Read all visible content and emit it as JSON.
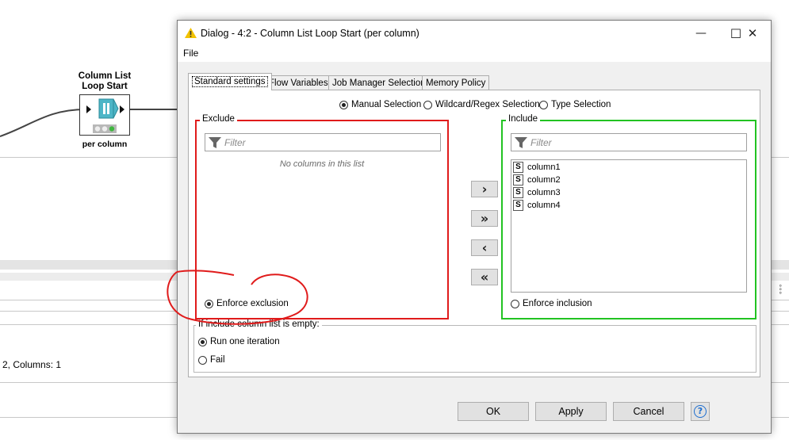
{
  "background": {
    "node": {
      "title": "Column List Loop Start",
      "subtitle": "per column"
    },
    "status_text": "2, Columns: 1",
    "right_edge_glyph": "°°°"
  },
  "dialog": {
    "title": "Dialog - 4:2 - Column List Loop Start (per column)",
    "window_controls": {
      "minimize": "—",
      "maximize": "☐",
      "close": "✕"
    },
    "menu": [
      "File"
    ],
    "tabs": [
      {
        "label": "Standard settings",
        "active": true
      },
      {
        "label": "Flow Variables",
        "active": false
      },
      {
        "label": "Job Manager Selection",
        "active": false
      },
      {
        "label": "Memory Policy",
        "active": false
      }
    ],
    "selection_modes": [
      {
        "label": "Manual Selection",
        "selected": true
      },
      {
        "label": "Wildcard/Regex Selection",
        "selected": false
      },
      {
        "label": "Type Selection",
        "selected": false
      }
    ],
    "exclude": {
      "label": "Exclude",
      "filter_placeholder": "Filter",
      "empty_text": "No columns in this list",
      "enforce_label": "Enforce exclusion",
      "enforce_selected": true,
      "border_color": "#e01b1b"
    },
    "include": {
      "label": "Include",
      "filter_placeholder": "Filter",
      "columns": [
        {
          "type": "S",
          "name": "column1"
        },
        {
          "type": "S",
          "name": "column2"
        },
        {
          "type": "S",
          "name": "column3"
        },
        {
          "type": "S",
          "name": "column4"
        }
      ],
      "enforce_label": "Enforce inclusion",
      "enforce_selected": false,
      "border_color": "#22c322"
    },
    "move_buttons": [
      "›",
      "»",
      "‹",
      "«"
    ],
    "empty_list": {
      "label": "If include column list is empty:",
      "options": [
        {
          "label": "Run one iteration",
          "selected": true
        },
        {
          "label": "Fail",
          "selected": false
        }
      ]
    },
    "buttons": {
      "ok": "OK",
      "apply": "Apply",
      "cancel": "Cancel",
      "help": "?"
    }
  },
  "colors": {
    "annotation": "#e01b1b",
    "warning_icon": "#f2c200",
    "help": "#1e6fd0"
  }
}
